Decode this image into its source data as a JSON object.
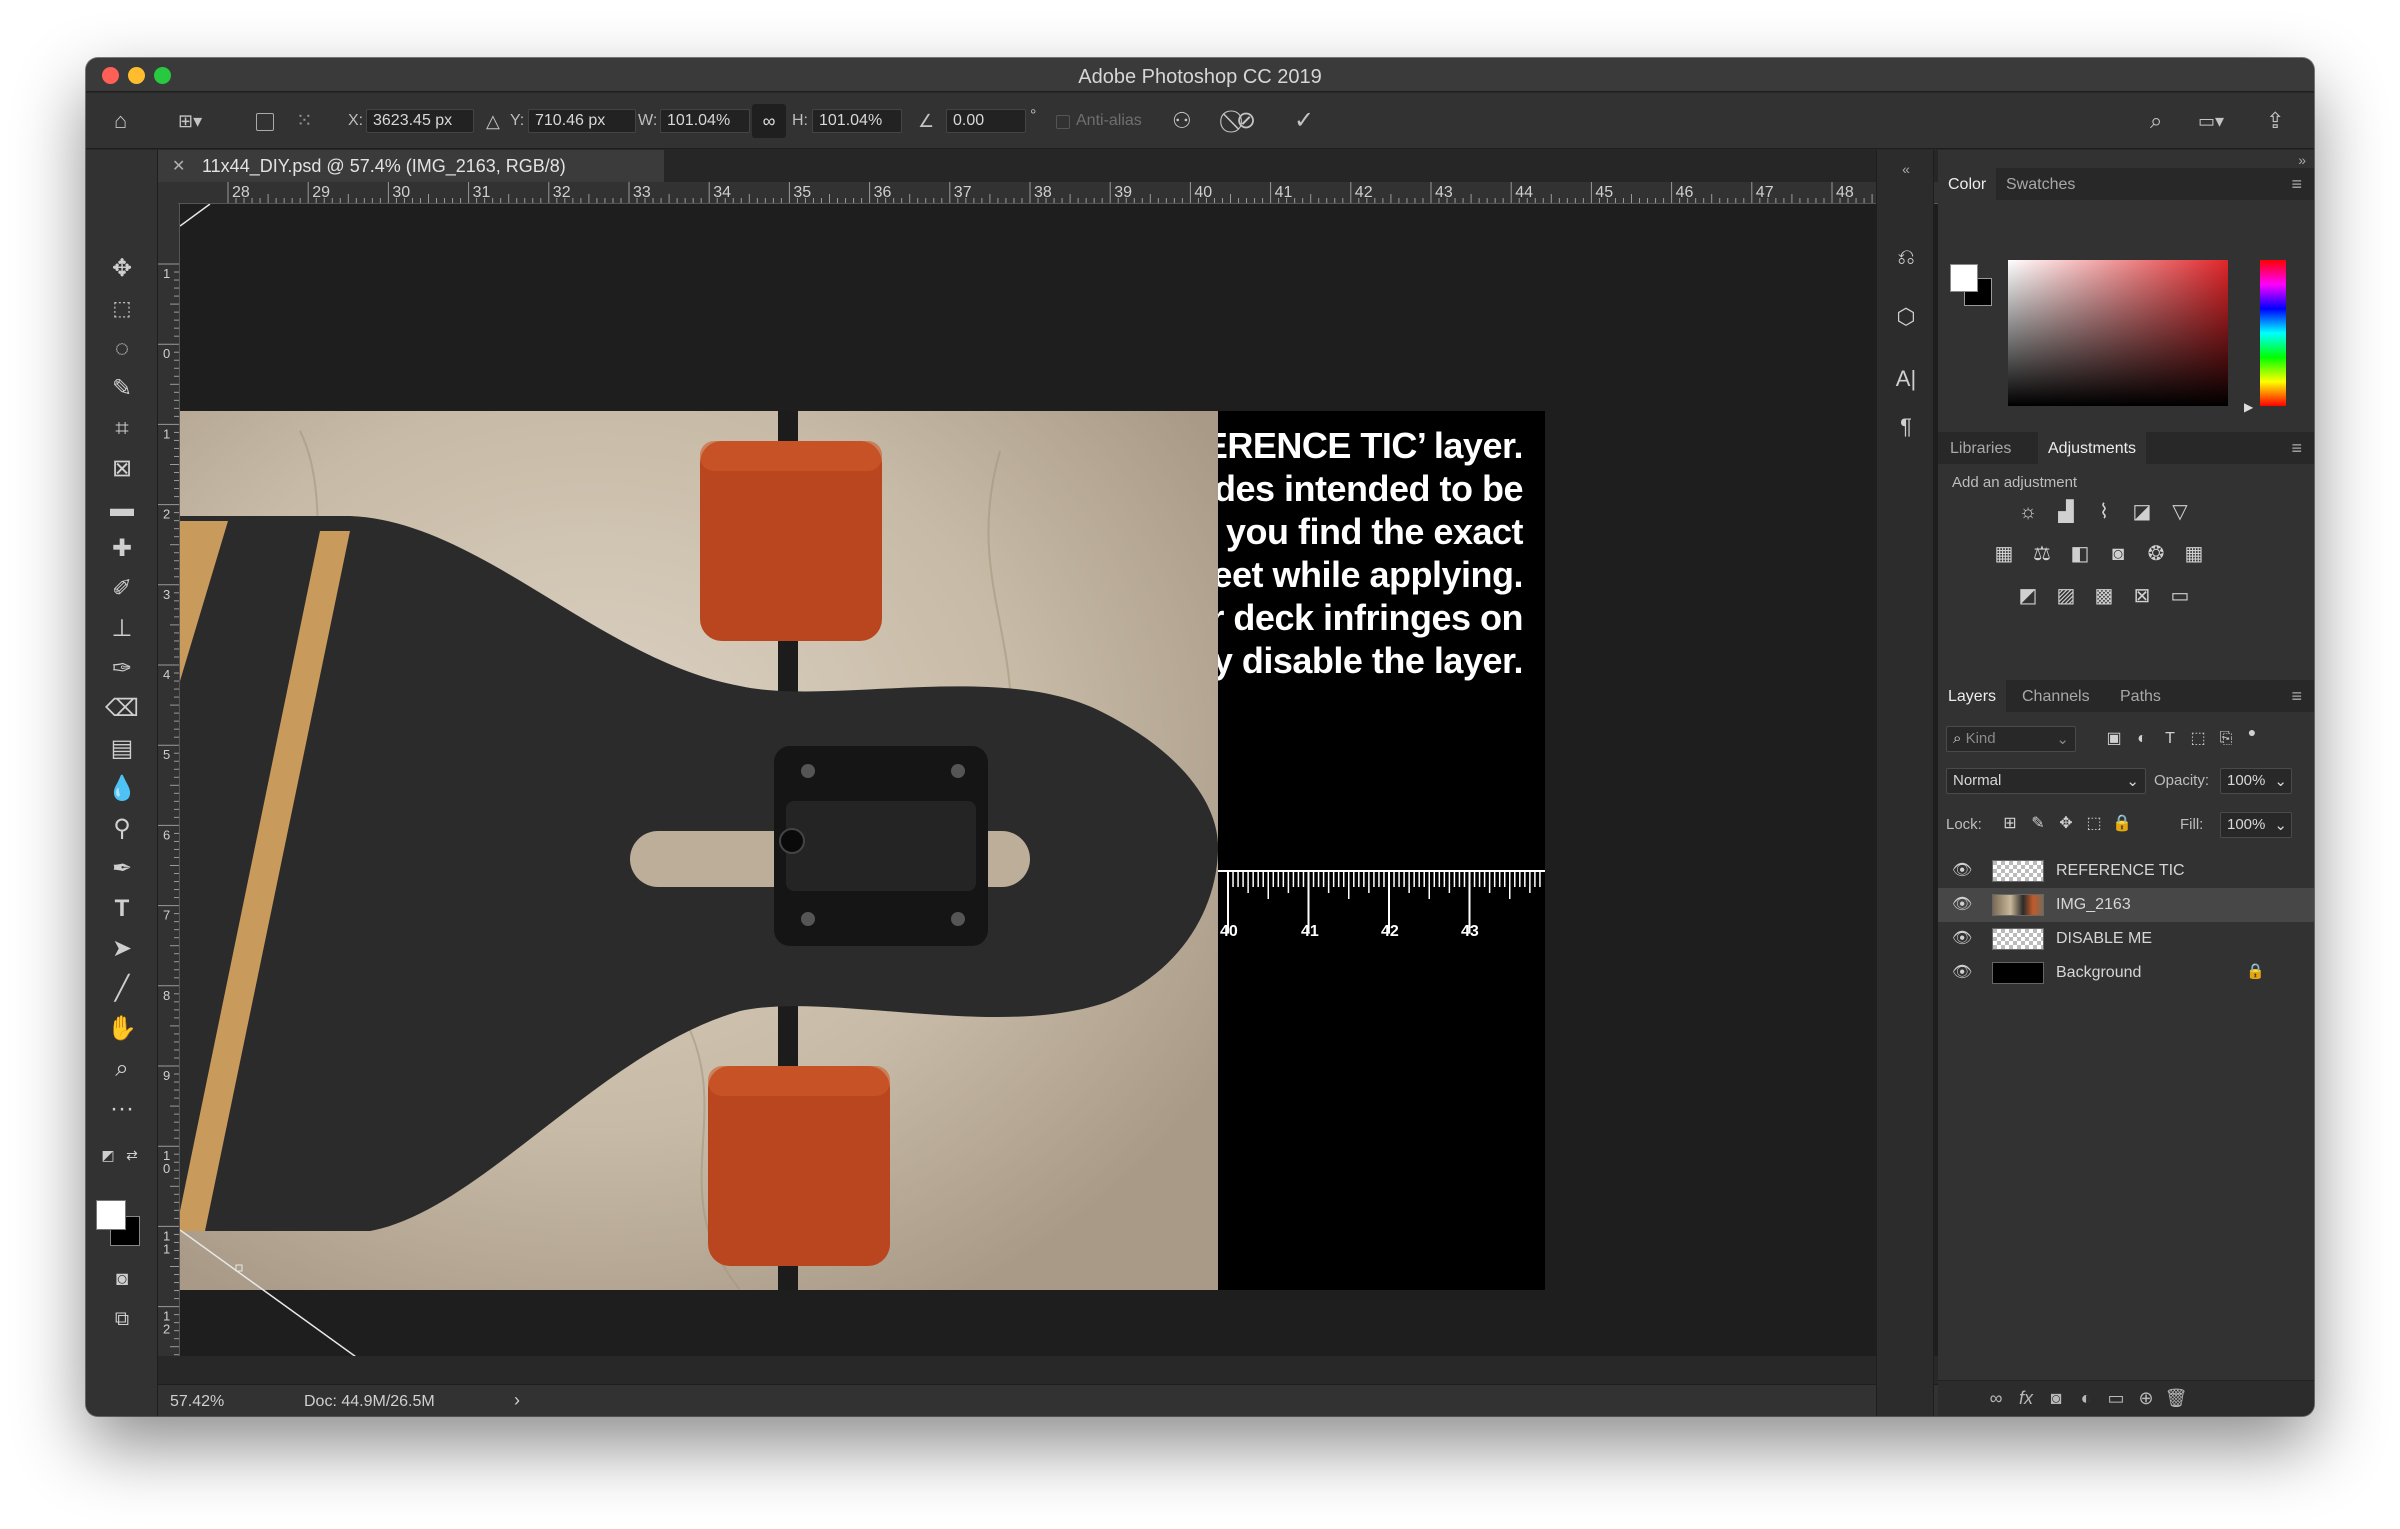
{
  "app": {
    "title": "Adobe Photoshop CC 2019"
  },
  "options_bar": {
    "x_label": "X:",
    "x_value": "3623.45 px",
    "y_label": "Y:",
    "y_value": "710.46 px",
    "w_label": "W:",
    "w_value": "101.04%",
    "h_label": "H:",
    "h_value": "101.04%",
    "angle_value": "0.00",
    "degree_symbol": "°",
    "antialias_label": "Anti-alias"
  },
  "document": {
    "tab_title": "11x44_DIY.psd @ 57.4% (IMG_2163, RGB/8)",
    "ref_text_lines": [
      "ERENCE TIC’ layer.",
      "ides intended to be",
      "o you find the exact",
      "heet while applying.",
      "r deck infringes on",
      "ly disable the layer."
    ],
    "tick_labels": [
      "40",
      "41",
      "42",
      "43"
    ]
  },
  "rulers": {
    "horizontal": [
      "28",
      "29",
      "30",
      "31",
      "32",
      "33",
      "34",
      "35",
      "36",
      "37",
      "38",
      "39",
      "40",
      "41",
      "42",
      "43",
      "44",
      "45",
      "46",
      "47",
      "48"
    ],
    "vertical": [
      "1",
      "0",
      "1",
      "2",
      "3",
      "4",
      "5",
      "6",
      "7",
      "8",
      "9",
      "1\n0",
      "1\n1",
      "1\n2"
    ]
  },
  "status_bar": {
    "zoom": "57.42%",
    "doc": "Doc: 44.9M/26.5M",
    "arrow": "›"
  },
  "color_panel": {
    "tabs": [
      "Color",
      "Swatches"
    ],
    "fg": "#ffffff",
    "bg": "#000000"
  },
  "adjustments_panel": {
    "tabs": [
      "Libraries",
      "Adjustments"
    ],
    "hint": "Add an adjustment"
  },
  "layers_panel": {
    "tabs": [
      "Layers",
      "Channels",
      "Paths"
    ],
    "kind_placeholder": "Kind",
    "blend_mode": "Normal",
    "opacity_label": "Opacity:",
    "opacity_value": "100%",
    "lock_label": "Lock:",
    "fill_label": "Fill:",
    "fill_value": "100%",
    "layers": [
      {
        "name": "REFERENCE TIC",
        "visible": true,
        "selected": false,
        "locked": false
      },
      {
        "name": "IMG_2163",
        "visible": true,
        "selected": true,
        "locked": false
      },
      {
        "name": "DISABLE ME",
        "visible": true,
        "selected": false,
        "locked": false
      },
      {
        "name": "Background",
        "visible": true,
        "selected": false,
        "locked": true
      }
    ]
  }
}
